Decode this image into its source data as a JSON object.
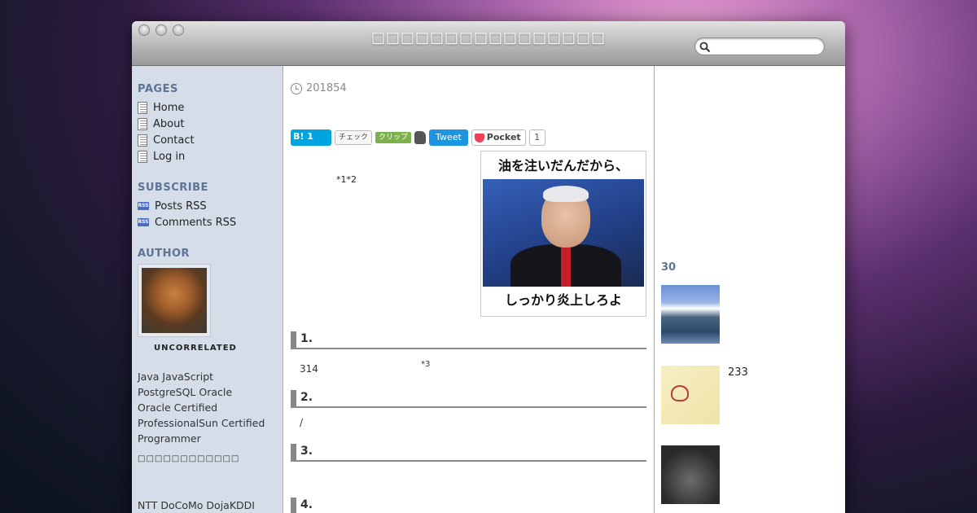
{
  "window": {
    "title": "□□□□□□□□□□□□□□□□"
  },
  "search": {
    "placeholder": ""
  },
  "sidebar": {
    "pages_heading": "PAGES",
    "pages": [
      "Home",
      "About",
      "Contact",
      "Log in"
    ],
    "subscribe_heading": "SUBSCRIBE",
    "subscribe": [
      "Posts RSS",
      "Comments RSS"
    ],
    "rss_icon_text": "RSS",
    "author_heading": "AUTHOR",
    "author_name": "UNCORRELATED",
    "bio_lines": [
      "Java JavaScript",
      "PostgreSQL Oracle",
      "Oracle Certified",
      "ProfessionalSun Certified",
      "Programmer"
    ],
    "bio_small": "□□□□□□□□□□□□",
    "bio_bottom": "NTT DoCoMo DojaKDDI"
  },
  "post": {
    "date": "201854",
    "share": {
      "hatena": "B! 1",
      "mixi": "チェック",
      "clip": "クリップ",
      "tweet": "Tweet",
      "pocket": "Pocket",
      "pocket_count": "1"
    },
    "footnote_refs": "*1*2",
    "image_top_text": "油を注いだんだから、",
    "image_bottom_text": "しっかり炎上しろよ",
    "sections": [
      {
        "heading": "1.",
        "text": "314",
        "note": "*3"
      },
      {
        "heading": "2.",
        "text": "/"
      },
      {
        "heading": "3.",
        "text": ""
      },
      {
        "heading": "4.",
        "text": ""
      }
    ]
  },
  "right": {
    "heading": "30",
    "item_count": "233"
  }
}
